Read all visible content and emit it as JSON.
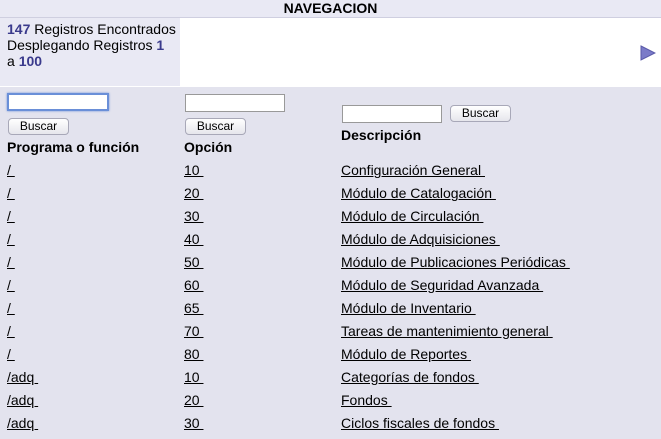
{
  "nav": {
    "title": "NAVEGACION"
  },
  "info": {
    "count": "147",
    "found_text": " Registros Encontrados",
    "display_text": "Desplegando Registros ",
    "from": "1",
    "separator": "a ",
    "to": "100"
  },
  "filters": {
    "programa": {
      "value": "",
      "button": "Buscar"
    },
    "opcion": {
      "value": "",
      "button": "Buscar"
    },
    "descripcion": {
      "value": "",
      "button": "Buscar"
    }
  },
  "columns": {
    "programa": "Programa o función",
    "opcion": "Opción",
    "descripcion": "Descripción"
  },
  "rows": [
    {
      "programa": "/",
      "opcion": "10",
      "descripcion": "Configuración General"
    },
    {
      "programa": "/",
      "opcion": "20",
      "descripcion": "Módulo de Catalogación"
    },
    {
      "programa": "/",
      "opcion": "30",
      "descripcion": "Módulo de Circulación"
    },
    {
      "programa": "/",
      "opcion": "40",
      "descripcion": "Módulo de Adquisiciones"
    },
    {
      "programa": "/",
      "opcion": "50",
      "descripcion": "Módulo de Publicaciones Periódicas"
    },
    {
      "programa": "/",
      "opcion": "60",
      "descripcion": "Módulo de Seguridad Avanzada"
    },
    {
      "programa": "/",
      "opcion": "65",
      "descripcion": "Módulo de Inventario"
    },
    {
      "programa": "/",
      "opcion": "70",
      "descripcion": "Tareas de mantenimiento general"
    },
    {
      "programa": "/",
      "opcion": "80",
      "descripcion": "Módulo de Reportes"
    },
    {
      "programa": "/adq",
      "opcion": "10",
      "descripcion": "Categorías de fondos"
    },
    {
      "programa": "/adq",
      "opcion": "20",
      "descripcion": "Fondos"
    },
    {
      "programa": "/adq",
      "opcion": "30",
      "descripcion": "Ciclos fiscales de fondos"
    }
  ],
  "icons": {
    "next": "next-arrow-icon"
  },
  "colors": {
    "accent": "#3a3a8c",
    "arrow": "#7b7bc8",
    "panel": "#e3e3ee"
  }
}
